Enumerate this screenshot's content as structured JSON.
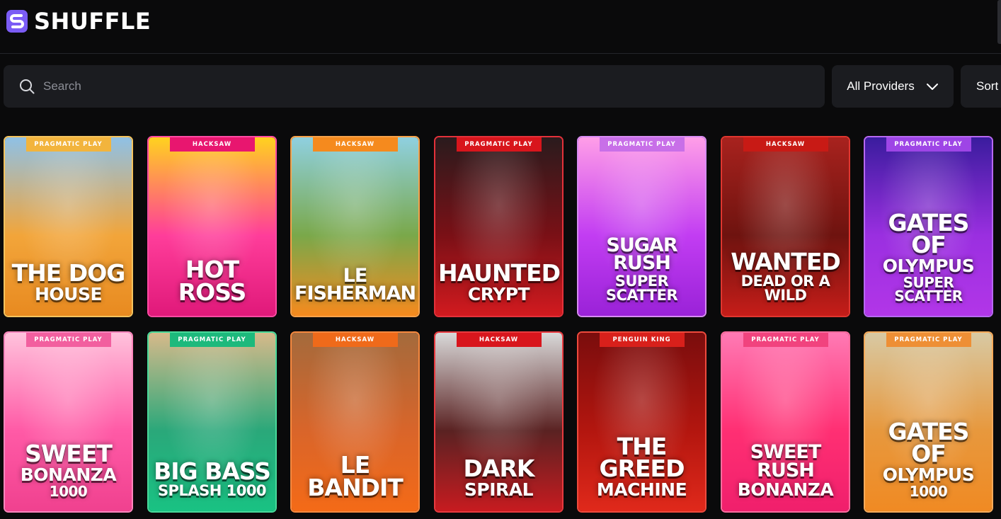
{
  "brand": {
    "name": "SHUFFLE",
    "accent": "#7b5cf5"
  },
  "search": {
    "placeholder": "Search",
    "icon": "search-icon"
  },
  "filters": {
    "providers_label": "All Providers",
    "sort_label": "Sort"
  },
  "games": [
    {
      "provider": "PRAGMATIC PLAY",
      "t1": "THE DOG",
      "t2": "HOUSE",
      "t3": "",
      "bg": [
        "#8fc1e6",
        "#f2a53a",
        "#e88a20"
      ],
      "tag": "#f2b43d",
      "border": "#f4c35e"
    },
    {
      "provider": "HACKSAW",
      "t1": "HOT ROSS",
      "t2": "",
      "t3": "",
      "bg": [
        "#ffd21f",
        "#ff3d9a",
        "#e0197a"
      ],
      "tag": "#e8166f",
      "border": "#ff4aa3"
    },
    {
      "provider": "HACKSAW",
      "t1": "LE FISHERMAN",
      "t2": "",
      "t3": "",
      "bg": [
        "#8fd0e0",
        "#7aa84a",
        "#f58a1e"
      ],
      "tag": "#f58a1e",
      "border": "#f7a24a"
    },
    {
      "provider": "PRAGMATIC PLAY",
      "t1": "HAUNTED",
      "t2": "CRYPT",
      "t3": "",
      "bg": [
        "#2a1b1d",
        "#7a1016",
        "#d21a1f"
      ],
      "tag": "#d8151c",
      "border": "#e4313a"
    },
    {
      "provider": "PRAGMATIC PLAY",
      "t1": "SUGAR RUSH",
      "t2": "SUPER SCATTER",
      "t3": "",
      "bg": [
        "#ff9ee8",
        "#c23df2",
        "#9a22d8"
      ],
      "tag": "#c86fe8",
      "border": "#d78bf2"
    },
    {
      "provider": "HACKSAW",
      "t1": "WANTED",
      "t2": "DEAD OR A WILD",
      "t3": "",
      "bg": [
        "#a8221e",
        "#6e130f",
        "#c61d19"
      ],
      "tag": "#c81a15",
      "border": "#e0362f"
    },
    {
      "provider": "PRAGMATIC PLAY",
      "t1": "GATES OF",
      "t2": "OLYMPUS",
      "t3": "SUPER SCATTER",
      "bg": [
        "#3a1c9e",
        "#9a2fe0",
        "#b236e8"
      ],
      "tag": "#9e45e6",
      "border": "#b768f2"
    },
    {
      "provider": "PRAGMATIC PLAY",
      "t1": "SWEET",
      "t2": "BONANZA",
      "t3": "1000",
      "bg": [
        "#ffc2dc",
        "#ff5aa6",
        "#f0418f"
      ],
      "tag": "#f25f9f",
      "border": "#ff86bd"
    },
    {
      "provider": "PRAGMATIC PLAY",
      "t1": "BIG BASS",
      "t2": "SPLASH 1000",
      "t3": "",
      "bg": [
        "#d7b98a",
        "#2aa87a",
        "#19c283"
      ],
      "tag": "#1db97c",
      "border": "#48d99a"
    },
    {
      "provider": "HACKSAW",
      "t1": "LE BANDIT",
      "t2": "",
      "t3": "",
      "bg": [
        "#a46a3c",
        "#d9652a",
        "#f46a17"
      ],
      "tag": "#ef6a1a",
      "border": "#f7893f"
    },
    {
      "provider": "HACKSAW",
      "t1": "DARK",
      "t2": "SPIRAL",
      "t3": "",
      "bg": [
        "#d9d9d9",
        "#5a2222",
        "#c71b20"
      ],
      "tag": "#d8161d",
      "border": "#e83a3f"
    },
    {
      "provider": "PENGUIN KING",
      "t1": "THE GREED",
      "t2": "MACHINE",
      "t3": "",
      "bg": [
        "#7a0d0d",
        "#b3160f",
        "#e0291b"
      ],
      "tag": "#d8201b",
      "border": "#ee4a3d"
    },
    {
      "provider": "PRAGMATIC PLAY",
      "t1": "SWEET RUSH",
      "t2": "BONANZA",
      "t3": "",
      "bg": [
        "#ff7ab4",
        "#ff2f73",
        "#f01f6c"
      ],
      "tag": "#f1437e",
      "border": "#ff6d9f"
    },
    {
      "provider": "PRAGMATIC PLAY",
      "t1": "GATES OF",
      "t2": "OLYMPUS",
      "t3": "1000",
      "bg": [
        "#d8c9a3",
        "#e7983d",
        "#f08a23"
      ],
      "tag": "#ee8f35",
      "border": "#f6aa5a"
    }
  ]
}
